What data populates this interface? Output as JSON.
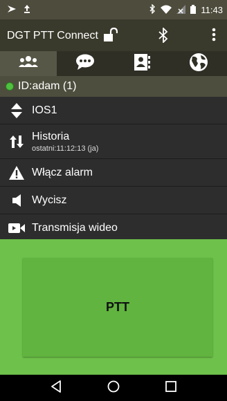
{
  "status_bar": {
    "time": "11:43",
    "notification_icons": [
      "location-arrow-icon",
      "upload-icon"
    ],
    "system_icons": [
      "bluetooth-icon",
      "wifi-icon",
      "signal-icon",
      "battery-icon"
    ]
  },
  "app_bar": {
    "title": "DGT PTT Connect",
    "icons": [
      "unlock-icon",
      "bluetooth-icon",
      "more-vert-icon"
    ]
  },
  "tabs": [
    {
      "icon": "contacts-group-icon",
      "active": true
    },
    {
      "icon": "chat-bubble-icon",
      "active": false
    },
    {
      "icon": "address-book-icon",
      "active": false
    },
    {
      "icon": "globe-icon",
      "active": false
    }
  ],
  "id_bar": {
    "label": "ID:adam (1)",
    "status_color": "#4fc03f"
  },
  "menu": [
    {
      "label": "IOS1",
      "icon": "up-down-arrow-icon"
    },
    {
      "label": "Historia",
      "sub": "ostatni:11:12:13 (ja)",
      "icon": "swap-vertical-icon"
    },
    {
      "label": "Włącz alarm",
      "icon": "warning-icon"
    },
    {
      "label": "Wycisz",
      "icon": "speaker-icon"
    },
    {
      "label": "Transmisja wideo",
      "icon": "video-camera-icon"
    }
  ],
  "ptt": {
    "label": "PTT"
  },
  "nav_bar": [
    "back-icon",
    "home-icon",
    "recent-apps-icon"
  ]
}
